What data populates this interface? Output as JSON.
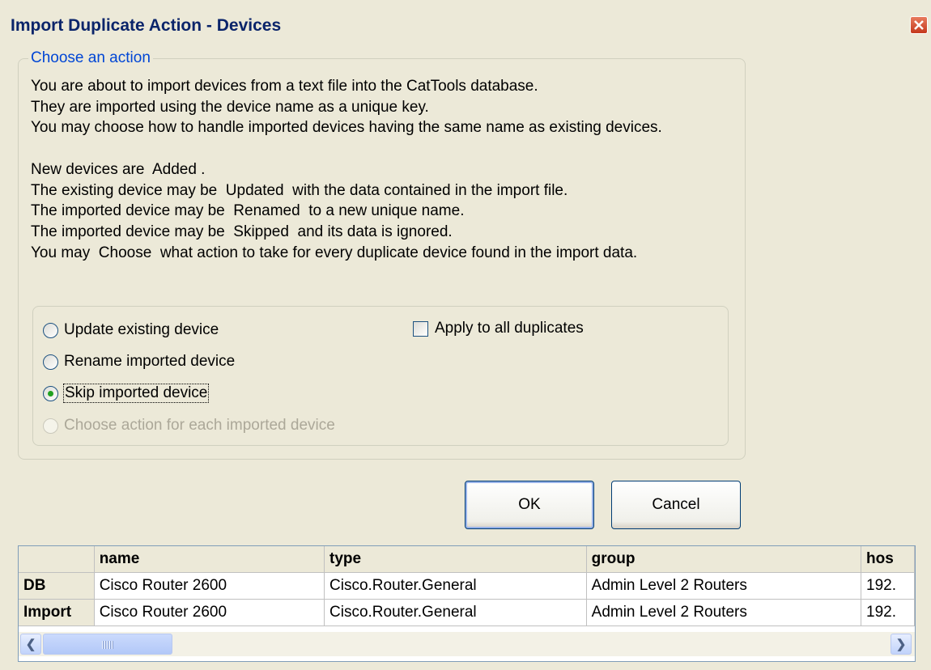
{
  "window": {
    "title": "Import Duplicate Action - Devices",
    "close_icon": "close-icon"
  },
  "group": {
    "legend": "Choose an action",
    "description": "You are about to import devices from a text file into the CatTools database.\nThey are imported using the device name as a unique key.\nYou may choose how to handle imported devices having the same name as existing devices.\n\nNew devices are  Added .\nThe existing device may be  Updated  with the data contained in the import file.\nThe imported device may be  Renamed  to a new unique name.\nThe imported device may be  Skipped  and its data is ignored.\nYou may  Choose  what action to take for every duplicate device found in the import data."
  },
  "options": [
    {
      "label": "Update  existing device",
      "checked": false,
      "disabled": false
    },
    {
      "label": "Rename  imported device",
      "checked": false,
      "disabled": false
    },
    {
      "label": "Skip imported device",
      "checked": true,
      "disabled": false
    },
    {
      "label": "Choose  action for each imported device",
      "checked": false,
      "disabled": true
    }
  ],
  "apply_all": {
    "label": "Apply to all duplicates",
    "checked": false
  },
  "buttons": {
    "ok": "OK",
    "cancel": "Cancel"
  },
  "grid": {
    "columns": [
      "",
      "name",
      "type",
      "group",
      "hos"
    ],
    "rows": [
      [
        "DB",
        "Cisco Router 2600",
        "Cisco.Router.General",
        "Admin Level 2 Routers",
        "192."
      ],
      [
        "Import",
        "Cisco Router 2600",
        "Cisco.Router.General",
        "Admin Level 2 Routers",
        "192."
      ]
    ],
    "scroll_left_icon": "chevron-left-icon",
    "scroll_right_icon": "chevron-right-icon"
  }
}
